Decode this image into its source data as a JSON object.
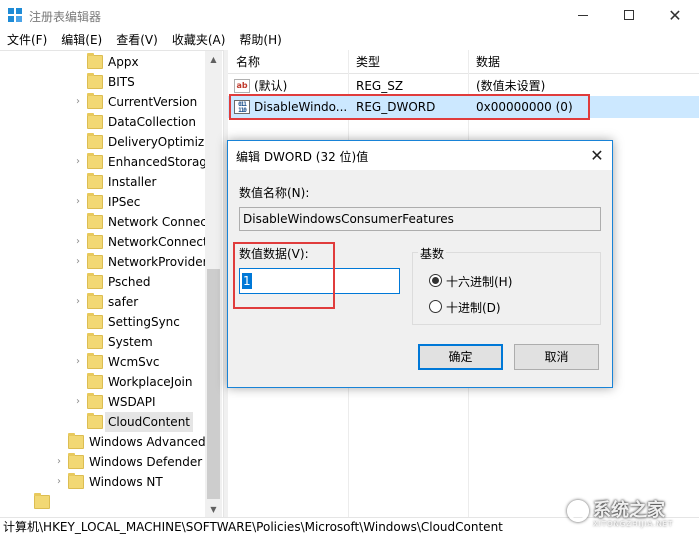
{
  "window": {
    "title": "注册表编辑器",
    "minimize_glyph": "",
    "maximize_glyph": "",
    "close_glyph": "✕"
  },
  "menu": [
    "文件(F)",
    "编辑(E)",
    "查看(V)",
    "收藏夹(A)",
    "帮助(H)"
  ],
  "tree": {
    "items": [
      {
        "label": "Appx",
        "expandable": false
      },
      {
        "label": "BITS",
        "expandable": false
      },
      {
        "label": "CurrentVersion",
        "expandable": true
      },
      {
        "label": "DataCollection",
        "expandable": false
      },
      {
        "label": "DeliveryOptimiza",
        "expandable": false
      },
      {
        "label": "EnhancedStorage",
        "expandable": true
      },
      {
        "label": "Installer",
        "expandable": false
      },
      {
        "label": "IPSec",
        "expandable": true
      },
      {
        "label": "Network Connec",
        "expandable": false
      },
      {
        "label": "NetworkConnect",
        "expandable": true
      },
      {
        "label": "NetworkProvider",
        "expandable": true
      },
      {
        "label": "Psched",
        "expandable": false
      },
      {
        "label": "safer",
        "expandable": true
      },
      {
        "label": "SettingSync",
        "expandable": false
      },
      {
        "label": "System",
        "expandable": false
      },
      {
        "label": "WcmSvc",
        "expandable": true
      },
      {
        "label": "WorkplaceJoin",
        "expandable": false
      },
      {
        "label": "WSDAPI",
        "expandable": true
      },
      {
        "label": "CloudContent",
        "expandable": false,
        "selected": true
      }
    ],
    "parent_items": [
      {
        "label": "Windows Advanced",
        "expandable": false
      },
      {
        "label": "Windows Defender",
        "expandable": true
      },
      {
        "label": "Windows NT",
        "expandable": true
      }
    ]
  },
  "list": {
    "columns": [
      "名称",
      "类型",
      "数据"
    ],
    "rows": [
      {
        "icon": "string-value-icon",
        "icon_text": "ab",
        "name": "(默认)",
        "type": "REG_SZ",
        "data": "(数值未设置)"
      },
      {
        "icon": "binary-value-icon",
        "icon_text": "011 110",
        "name": "DisableWindo...",
        "type": "REG_DWORD",
        "data": "0x00000000 (0)",
        "selected": true
      }
    ]
  },
  "status_path": "计算机\\HKEY_LOCAL_MACHINE\\SOFTWARE\\Policies\\Microsoft\\Windows\\CloudContent",
  "dialog": {
    "title": "编辑 DWORD (32 位)值",
    "close_glyph": "✕",
    "name_label": "数值名称(N):",
    "name_value": "DisableWindowsConsumerFeatures",
    "data_label": "数值数据(V):",
    "data_value": "1",
    "base_label": "基数",
    "base_options": [
      {
        "label": "十六进制(H)",
        "checked": true
      },
      {
        "label": "十进制(D)",
        "checked": false
      }
    ],
    "ok_label": "确定",
    "cancel_label": "取消"
  },
  "watermark": {
    "main": "系统之家",
    "sub": "XITONGZHIJIA.NET"
  },
  "colors": {
    "highlight": "#e03c3c",
    "selection": "#cce8ff",
    "accent": "#0078d7",
    "folder": "#f2d874"
  }
}
